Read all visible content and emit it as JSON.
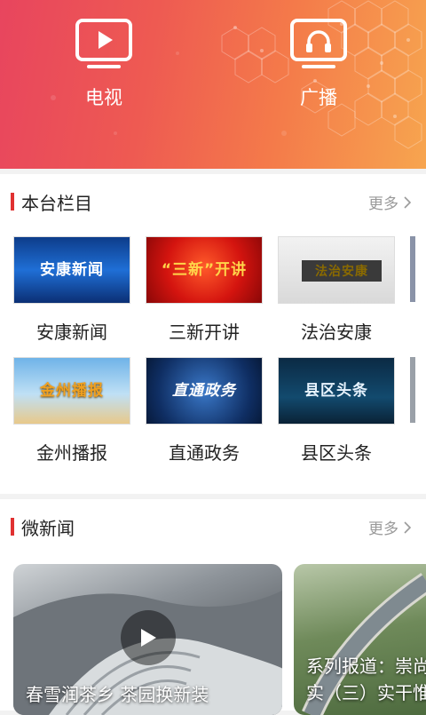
{
  "header": {
    "tv_label": "电视",
    "radio_label": "广播",
    "gradient_colors": [
      "#e8455e",
      "#f7a54f"
    ]
  },
  "programs_section": {
    "title": "本台栏目",
    "more": "更多",
    "accent": "#e03131",
    "items": [
      {
        "name": "安康新闻",
        "thumb_text": "安康新闻"
      },
      {
        "name": "三新开讲",
        "thumb_text": "“三新”开讲"
      },
      {
        "name": "法治安康",
        "thumb_text": "法治安康"
      },
      {
        "name": "金州播报",
        "thumb_text": "金州播报"
      },
      {
        "name": "直通政务",
        "thumb_text": "直通政务"
      },
      {
        "name": "县区头条",
        "thumb_text": "县区头条"
      }
    ]
  },
  "micro_news_section": {
    "title": "微新闻",
    "more": "更多",
    "items": [
      {
        "caption": "春雪润茶乡  茶园换新装"
      },
      {
        "caption": "系列报道：崇尚实（三）实干惟"
      }
    ]
  }
}
